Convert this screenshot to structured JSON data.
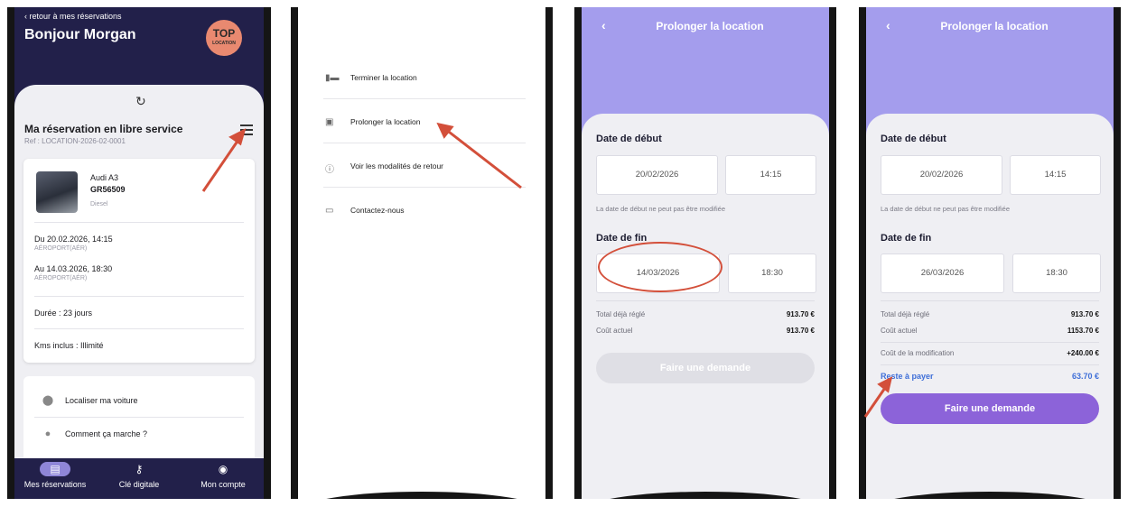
{
  "phone1": {
    "back_label": "retour à mes réservations",
    "greeting": "Bonjour Morgan",
    "logo_text": "TOP",
    "logo_sub": "LOCATION",
    "refresh_icon": "refresh-icon",
    "reservation_title": "Ma réservation en libre service",
    "reservation_ref": "Ref : LOCATION-2026-02-0001",
    "car": {
      "model": "Audi A3",
      "plate": "GR56509",
      "fuel": "Diesel"
    },
    "from_label": "Du 20.02.2026, 14:15",
    "from_place": "AÉROPORT(AÉR)",
    "to_label": "Au 14.03.2026, 18:30",
    "to_place": "AÉROPORT(AÉR)",
    "duration": "Durée : 23 jours",
    "kms": "Kms inclus : Illimité",
    "links": [
      {
        "label": "Localiser ma voiture",
        "icon": "map-pin-icon"
      },
      {
        "label": "Comment ça marche ?",
        "icon": "info-icon"
      }
    ],
    "tabs": [
      {
        "label": "Mes réservations",
        "icon": "list-icon",
        "active": true
      },
      {
        "label": "Clé digitale",
        "icon": "key-icon",
        "active": false
      },
      {
        "label": "Mon compte",
        "icon": "account-icon",
        "active": false
      }
    ]
  },
  "phone2": {
    "menu_items": [
      {
        "label": "Terminer la location",
        "icon": "finish-flag-icon"
      },
      {
        "label": "Prolonger la location",
        "icon": "calendar-icon"
      },
      {
        "label": "Voir les modalités de retour",
        "icon": "info-icon"
      },
      {
        "label": "Contactez-nous",
        "icon": "contact-icon"
      }
    ]
  },
  "phone3": {
    "title": "Prolonger la location",
    "start_heading": "Date de début",
    "start_date": "20/02/2026",
    "start_time": "14:15",
    "start_note": "La date de début ne peut pas être modifiée",
    "end_heading": "Date de fin",
    "end_date": "14/03/2026",
    "end_time": "18:30",
    "total_paid_label": "Total déjà réglé",
    "total_paid_value": "913.70 €",
    "current_cost_label": "Coût actuel",
    "current_cost_value": "913.70 €",
    "button_label": "Faire une demande"
  },
  "phone4": {
    "title": "Prolonger la location",
    "start_heading": "Date de début",
    "start_date": "20/02/2026",
    "start_time": "14:15",
    "start_note": "La date de début ne peut pas être modifiée",
    "end_heading": "Date de fin",
    "end_date": "26/03/2026",
    "end_time": "18:30",
    "total_paid_label": "Total déjà réglé",
    "total_paid_value": "913.70 €",
    "current_cost_label": "Coût actuel",
    "current_cost_value": "1153.70 €",
    "modification_cost_label": "Coût de la modification",
    "modification_cost_value": "+240.00 €",
    "remaining_label": "Reste à payer",
    "remaining_value": "63.70 €",
    "button_label": "Faire une demande"
  },
  "colors": {
    "navy": "#22204a",
    "lavender": "#a49ded",
    "purple_button": "#8c63d9",
    "blue_text": "#3f6fd8",
    "annotation_red": "#d34f3a"
  }
}
